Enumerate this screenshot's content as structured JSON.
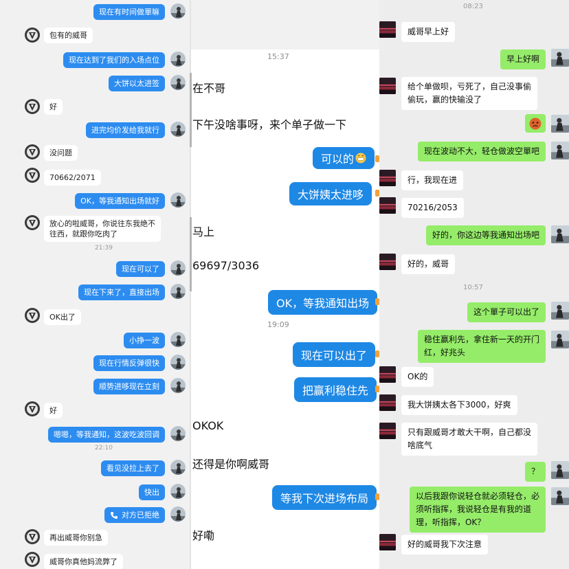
{
  "left": {
    "messages": [
      "现在有时间做單嘛",
      "包有的威哥",
      "现在达到了我们的入场点位",
      "大饼以太进签",
      "好",
      "进完均价发给我就行",
      "没问题",
      "70662/2071",
      "OK，等我通知出场就好",
      "放心的啦威哥，你说往东我绝不",
      "往西，就跟你吃肉了",
      "现在可以了",
      "现在下来了，直接出场",
      "OK出了",
      "小挣一波",
      "现在行情反弹很快",
      "顺势进哆现在立刻",
      "好",
      "嗯嗯，等我通知，这波吃波回调",
      "看见没拉上去了",
      "快出",
      "对方已拒绝",
      "再出威哥你别急",
      "威哥你真他妈流弊了"
    ],
    "times": [
      "21:39",
      "22:10"
    ]
  },
  "middle": {
    "time_top": "15:37",
    "time_mid": "19:09",
    "messages": [
      "在不哥",
      "下午没啥事呀，来个单子做一下",
      "可以的",
      "大饼姨太进哆",
      "马上",
      "69697/3036",
      "OK，等我通知出场",
      "现在可以出了",
      "把赢利稳住先",
      "OKOK",
      "还得是你啊威哥",
      "等我下次进场布局",
      "好嘞"
    ]
  },
  "right": {
    "times": [
      "08:23",
      "10:57"
    ],
    "messages": [
      "威哥早上好",
      "早上好啊",
      "给个单做呗，亏死了，自己没事偷",
      "偷玩，赢的快输没了",
      "现在波动不大，轻仓做波空單吧",
      "行，我现在进",
      "70216/2053",
      "好的，你这边等我通知出场吧",
      "好的，威哥",
      "这个單子可以出了",
      "稳住赢利先，拿住新一天的开门",
      "红，好兆头",
      "OK的",
      "我大饼姨太各下3000，好爽",
      "只有跟威哥才敢大干啊，自己都没",
      "啥底气",
      "？",
      "以后我跟你说轻仓就必须轻仓，必",
      "须听指挥，我说轻仓是有我的道",
      "理，听指挥，OK？",
      "好的威哥我下次注意"
    ]
  },
  "colors": {
    "left_out": "#2d8cf0",
    "middle_out": "#1e88e5",
    "right_out": "#95ec69"
  }
}
